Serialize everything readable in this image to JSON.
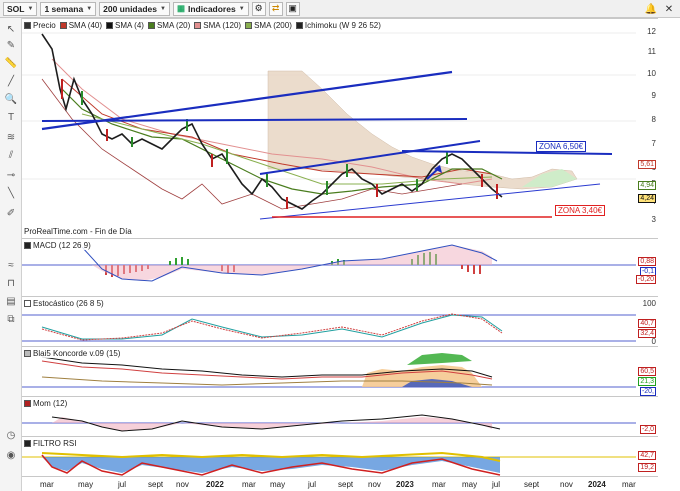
{
  "toolbar": {
    "symbol": "SOL",
    "period": "1 semana",
    "units": "200 unidades",
    "indicators": "Indicadores"
  },
  "main_legend": {
    "items": [
      {
        "label": "Precio",
        "color": "#333333"
      },
      {
        "label": "SMA (40)",
        "color": "#c0392b"
      },
      {
        "label": "SMA (4)",
        "color": "#111111"
      },
      {
        "label": "SMA (20)",
        "color": "#4a7d1e"
      },
      {
        "label": "SMA (120)",
        "color": "#e29090"
      },
      {
        "label": "SMA (200)",
        "color": "#8ab050"
      },
      {
        "label": "Ichimoku (W 9 26 52)",
        "color": "#222222"
      }
    ]
  },
  "main_axis": [
    "12",
    "11",
    "10",
    "9",
    "8",
    "7",
    "6",
    "5",
    "4",
    "3"
  ],
  "main_badges": [
    "5,61",
    "4,94",
    "4,24"
  ],
  "annotations": {
    "zona_top": "ZONA 6,50€",
    "zona_bottom": "ZONA 3,40€",
    "source": "ProRealTime.com - Fin de Día"
  },
  "panels": {
    "macd": {
      "label": "MACD (12 26 9)",
      "badges": [
        "0,88",
        "-0,1",
        "-0,20"
      ]
    },
    "stoch": {
      "label": "Estocástico (26 8 5)",
      "axis": [
        "100",
        "0"
      ],
      "badges": [
        "40,7",
        "32,4"
      ]
    },
    "blai": {
      "label": "Blai5 Koncorde v.09 (15)",
      "badges": [
        "60,5",
        "21,3",
        "-20,"
      ]
    },
    "mom": {
      "label": "Mom (12)",
      "badges": [
        "-2,0"
      ]
    },
    "rsi": {
      "label": "FILTRO RSI",
      "badges": [
        "42,7",
        "19,2"
      ]
    }
  },
  "xaxis": [
    {
      "label": "mar",
      "year": false
    },
    {
      "label": "may",
      "year": false
    },
    {
      "label": "jul",
      "year": false
    },
    {
      "label": "sept",
      "year": false
    },
    {
      "label": "nov",
      "year": false
    },
    {
      "label": "2022",
      "year": true
    },
    {
      "label": "mar",
      "year": false
    },
    {
      "label": "may",
      "year": false
    },
    {
      "label": "jul",
      "year": false
    },
    {
      "label": "sept",
      "year": false
    },
    {
      "label": "nov",
      "year": false
    },
    {
      "label": "2023",
      "year": true
    },
    {
      "label": "mar",
      "year": false
    },
    {
      "label": "may",
      "year": false
    },
    {
      "label": "jul",
      "year": false
    },
    {
      "label": "sept",
      "year": false
    },
    {
      "label": "nov",
      "year": false
    },
    {
      "label": "2024",
      "year": true
    },
    {
      "label": "mar",
      "year": false
    }
  ],
  "colors": {
    "trendline": "#1a2dbf",
    "support": "#e02020",
    "cloud": "#e8d6c4"
  }
}
